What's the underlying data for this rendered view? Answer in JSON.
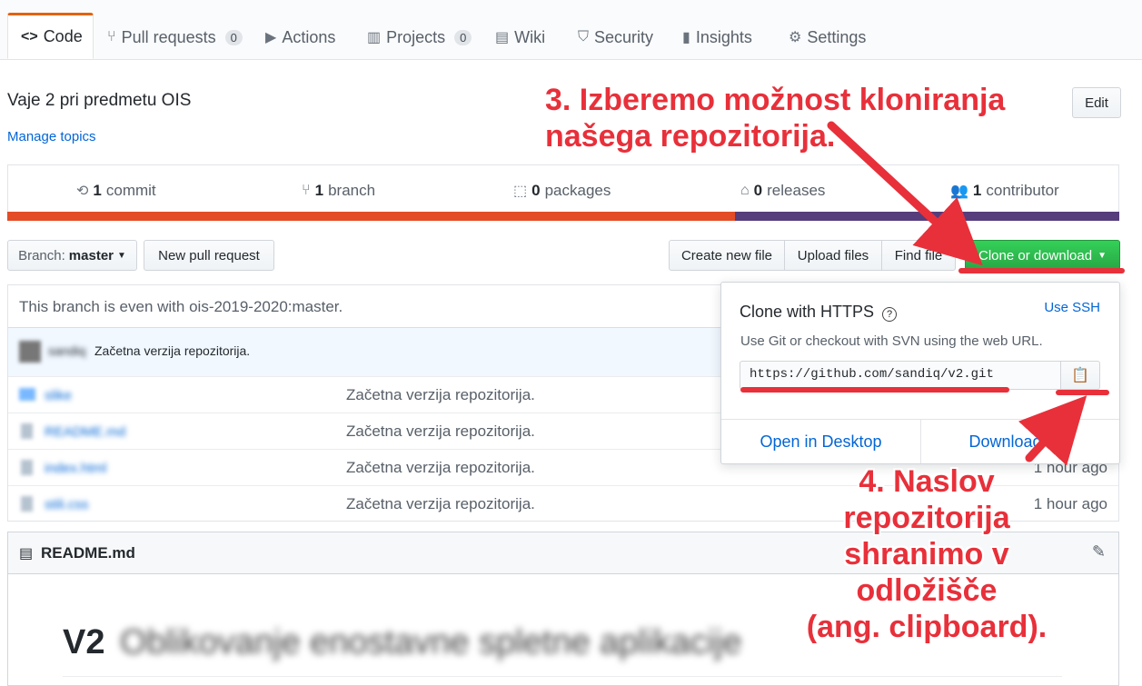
{
  "tabs": [
    {
      "label": "Code",
      "icon": "code-icon",
      "active": true
    },
    {
      "label": "Pull requests",
      "icon": "pull-request-icon",
      "count": "0"
    },
    {
      "label": "Actions",
      "icon": "play-icon"
    },
    {
      "label": "Projects",
      "icon": "project-icon",
      "count": "0"
    },
    {
      "label": "Wiki",
      "icon": "book-icon"
    },
    {
      "label": "Security",
      "icon": "shield-icon"
    },
    {
      "label": "Insights",
      "icon": "graph-icon"
    },
    {
      "label": "Settings",
      "icon": "gear-icon"
    }
  ],
  "repo": {
    "description": "Vaje 2 pri predmetu OIS",
    "manage_topics": "Manage topics",
    "edit_label": "Edit"
  },
  "summary": {
    "commits": {
      "count": "1",
      "label": "commit"
    },
    "branches": {
      "count": "1",
      "label": "branch"
    },
    "packages": {
      "count": "0",
      "label": "packages"
    },
    "releases": {
      "count": "0",
      "label": "releases"
    },
    "contributors": {
      "count": "1",
      "label": "contributor"
    }
  },
  "colors": {
    "lang_primary": "#e34c26",
    "lang_secondary": "#563d7c",
    "accent": "#2cbe4e",
    "annotation": "#e8303a"
  },
  "toolbar": {
    "branch_prefix": "Branch:",
    "branch_name": "master",
    "new_pr": "New pull request",
    "create_file": "Create new file",
    "upload_files": "Upload files",
    "find_file": "Find file",
    "clone": "Clone or download"
  },
  "branch_status": "This branch is even with ois-2019-2020:master.",
  "latest_commit": {
    "author": "sandiq",
    "message": "Začetna verzija repozitorija."
  },
  "files": [
    {
      "name": "slike",
      "message": "Začetna verzija repozitorija.",
      "age": ""
    },
    {
      "name": "README.md",
      "message": "Začetna verzija repozitorija.",
      "age": ""
    },
    {
      "name": "index.html",
      "message": "Začetna verzija repozitorija.",
      "age": "1 hour ago"
    },
    {
      "name": "stili.css",
      "message": "Začetna verzija repozitorija.",
      "age": "1 hour ago"
    }
  ],
  "clone": {
    "title": "Clone with HTTPS",
    "use_ssh": "Use SSH",
    "hint": "Use Git or checkout with SVN using the web URL.",
    "url": "https://github.com/sandiq/v2.git",
    "open_desktop": "Open in Desktop",
    "download_zip": "Download ZIP"
  },
  "readme": {
    "filename": "README.md",
    "heading": "V2",
    "heading_rest": "Oblikovanje enostavne spletne aplikacije"
  },
  "annotations": {
    "step3_line1": "3. Izberemo možnost kloniranja",
    "step3_line2": "našega repozitorija.",
    "step4_line1": "4. Naslov repozitorija",
    "step4_line2": "shranimo v odložišče",
    "step4_line3": "(ang. clipboard)."
  }
}
